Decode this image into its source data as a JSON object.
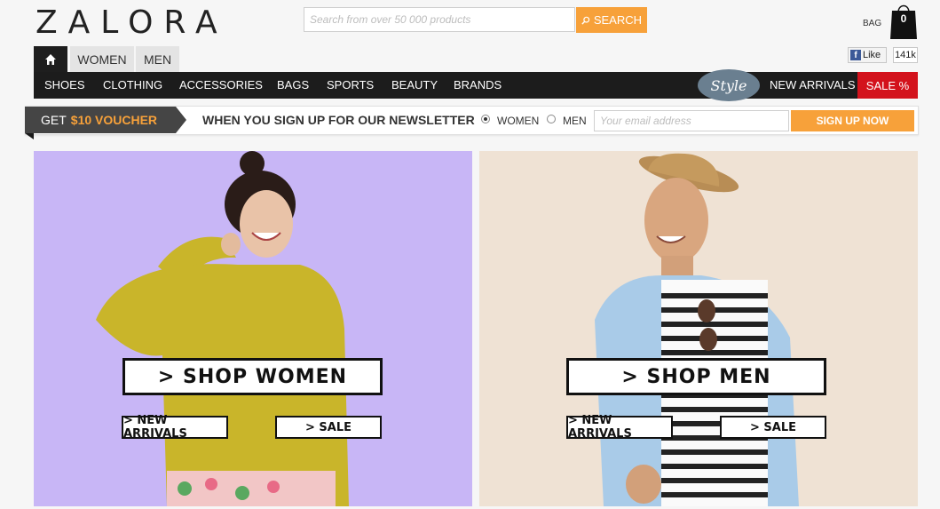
{
  "brand": {
    "logo": "ZALORA"
  },
  "search": {
    "placeholder": "Search from over 50 000 products",
    "button_label": "SEARCH"
  },
  "bag": {
    "label": "BAG",
    "count": "0"
  },
  "gender_tabs": {
    "women": "WOMEN",
    "men": "MEN"
  },
  "facebook": {
    "like_label": "Like",
    "count": "141k"
  },
  "nav": {
    "items": [
      "SHOES",
      "CLOTHING",
      "ACCESSORIES",
      "BAGS",
      "SPORTS",
      "BEAUTY",
      "BRANDS"
    ],
    "style_label": "Style",
    "new_arrivals": "NEW ARRIVALS",
    "sale": "SALE %"
  },
  "newsletter": {
    "voucher_prefix": "GET",
    "voucher_amount": "$10 VOUCHER",
    "text": "WHEN YOU SIGN UP FOR OUR NEWSLETTER",
    "option_women": "WOMEN",
    "option_men": "MEN",
    "selected": "WOMEN",
    "email_placeholder": "Your email address",
    "signup_label": "SIGN UP NOW"
  },
  "banners": {
    "women": {
      "shop_label": "> SHOP WOMEN",
      "new_arrivals": "> NEW ARRIVALS",
      "sale": "> SALE",
      "background": "#c8b6f6"
    },
    "men": {
      "shop_label": "> SHOP MEN",
      "new_arrivals": "> NEW ARRIVALS",
      "sale": "> SALE",
      "background": "#efe2d4"
    }
  },
  "colors": {
    "accent": "#f7a13a",
    "sale_red": "#d3121c",
    "nav_dark": "#1c1c1c"
  }
}
